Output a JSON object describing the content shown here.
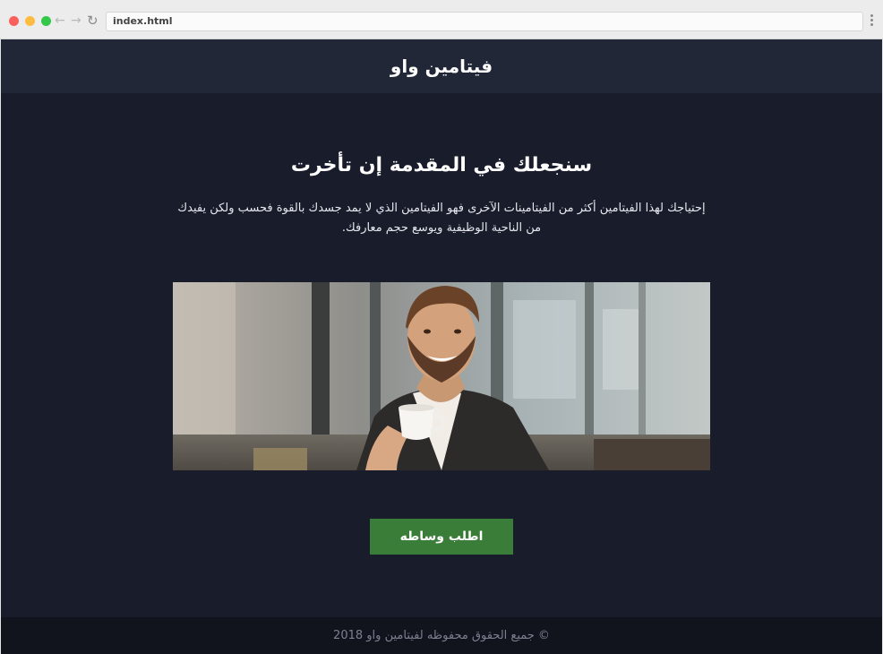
{
  "browser": {
    "url": "index.html",
    "icons": {
      "back": "back-arrow-icon",
      "forward": "forward-arrow-icon",
      "reload": "reload-icon",
      "menu": "kebab-menu-icon"
    },
    "traffic_lights": {
      "close": "#fc605c",
      "minimize": "#fdbc40",
      "maximize": "#34c84a"
    }
  },
  "header": {
    "title": "فيتامين واو"
  },
  "hero": {
    "headline": "سنجعلك في المقدمة إن تأخرت",
    "description": "إحتياجك لهذا الفيتامين أكثر من الفيتامينات الآخرى فهو الفيتامين الذي لا يمد جسدك بالقوة فحسب ولكن يفيدك من الناحية الوظيفية ويوسع حجم معارفك."
  },
  "cta": {
    "label": "اطلب وساطه"
  },
  "footer": {
    "copyright": "جميع الحقوق محفوظه لفيتامين واو 2018 ©"
  },
  "colors": {
    "page_background": "#191c2b",
    "header_background": "#222738",
    "footer_background": "#11131d",
    "button": "#3a7d38"
  }
}
